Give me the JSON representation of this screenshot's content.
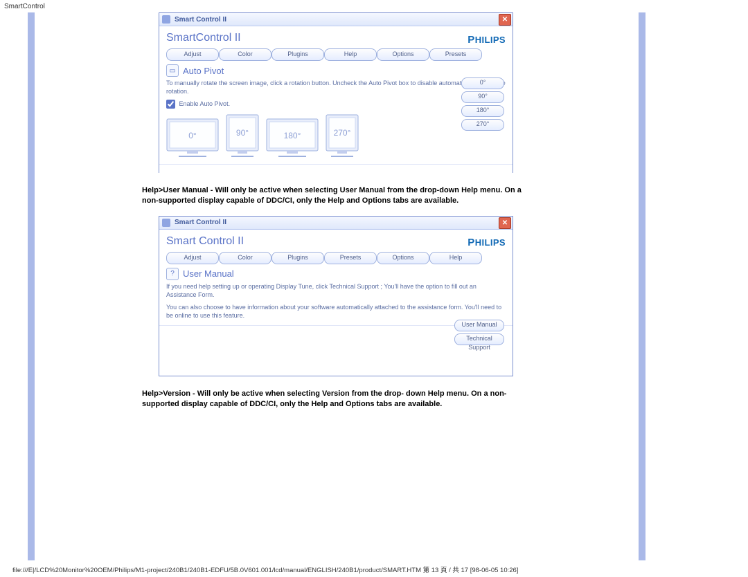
{
  "page_header": "SmartControl",
  "footer_path": "file:///E|/LCD%20Monitor%20OEM/Philips/M1-project/240B1/240B1-EDFU/5B.0V601.001/lcd/manual/ENGLISH/240B1/product/SMART.HTM 第 13 頁 / 共 17 [98-06-05 10:26]",
  "paragraphs": {
    "p1": "Help>User Manual - Will only be active when selecting User Manual from the drop-down Help menu. On a non-supported display capable of DDC/CI, only the Help and Options tabs are available.",
    "p2": "Help>Version - Will only be active when selecting Version from the drop- down Help menu. On a non-supported display capable of DDC/CI, only the Help and Options tabs are available."
  },
  "brand": "PHILIPS",
  "window1": {
    "title": "Smart Control II",
    "heading": "SmartControl II",
    "tabs": [
      "Adjust",
      "Color",
      "Plugins",
      "Help",
      "Options",
      "Presets"
    ],
    "section_title": "Auto Pivot",
    "instruction": "To manually rotate the screen image, click a rotation button. Uncheck the Auto Pivot box to disable automatic screen-image rotation.",
    "checkbox_label": "Enable Auto Pivot.",
    "rotations": [
      "0°",
      "90°",
      "180°",
      "270°"
    ],
    "side_buttons": [
      "0°",
      "90°",
      "180°",
      "270°"
    ]
  },
  "window2": {
    "title": "Smart Control II",
    "heading": "Smart Control II",
    "tabs": [
      "Adjust",
      "Color",
      "Plugins",
      "Presets",
      "Options",
      "Help"
    ],
    "section_title": "User Manual",
    "instruction1": "If you need help setting up or operating Display Tune, click Technical Support ; You'll have the option to fill out an Assistance Form.",
    "instruction2": "You can also choose to have information about your software automatically attached to the assistance form. You'll need to be online to use this feature.",
    "side_buttons": [
      "User Manual",
      "Technical Support"
    ]
  }
}
